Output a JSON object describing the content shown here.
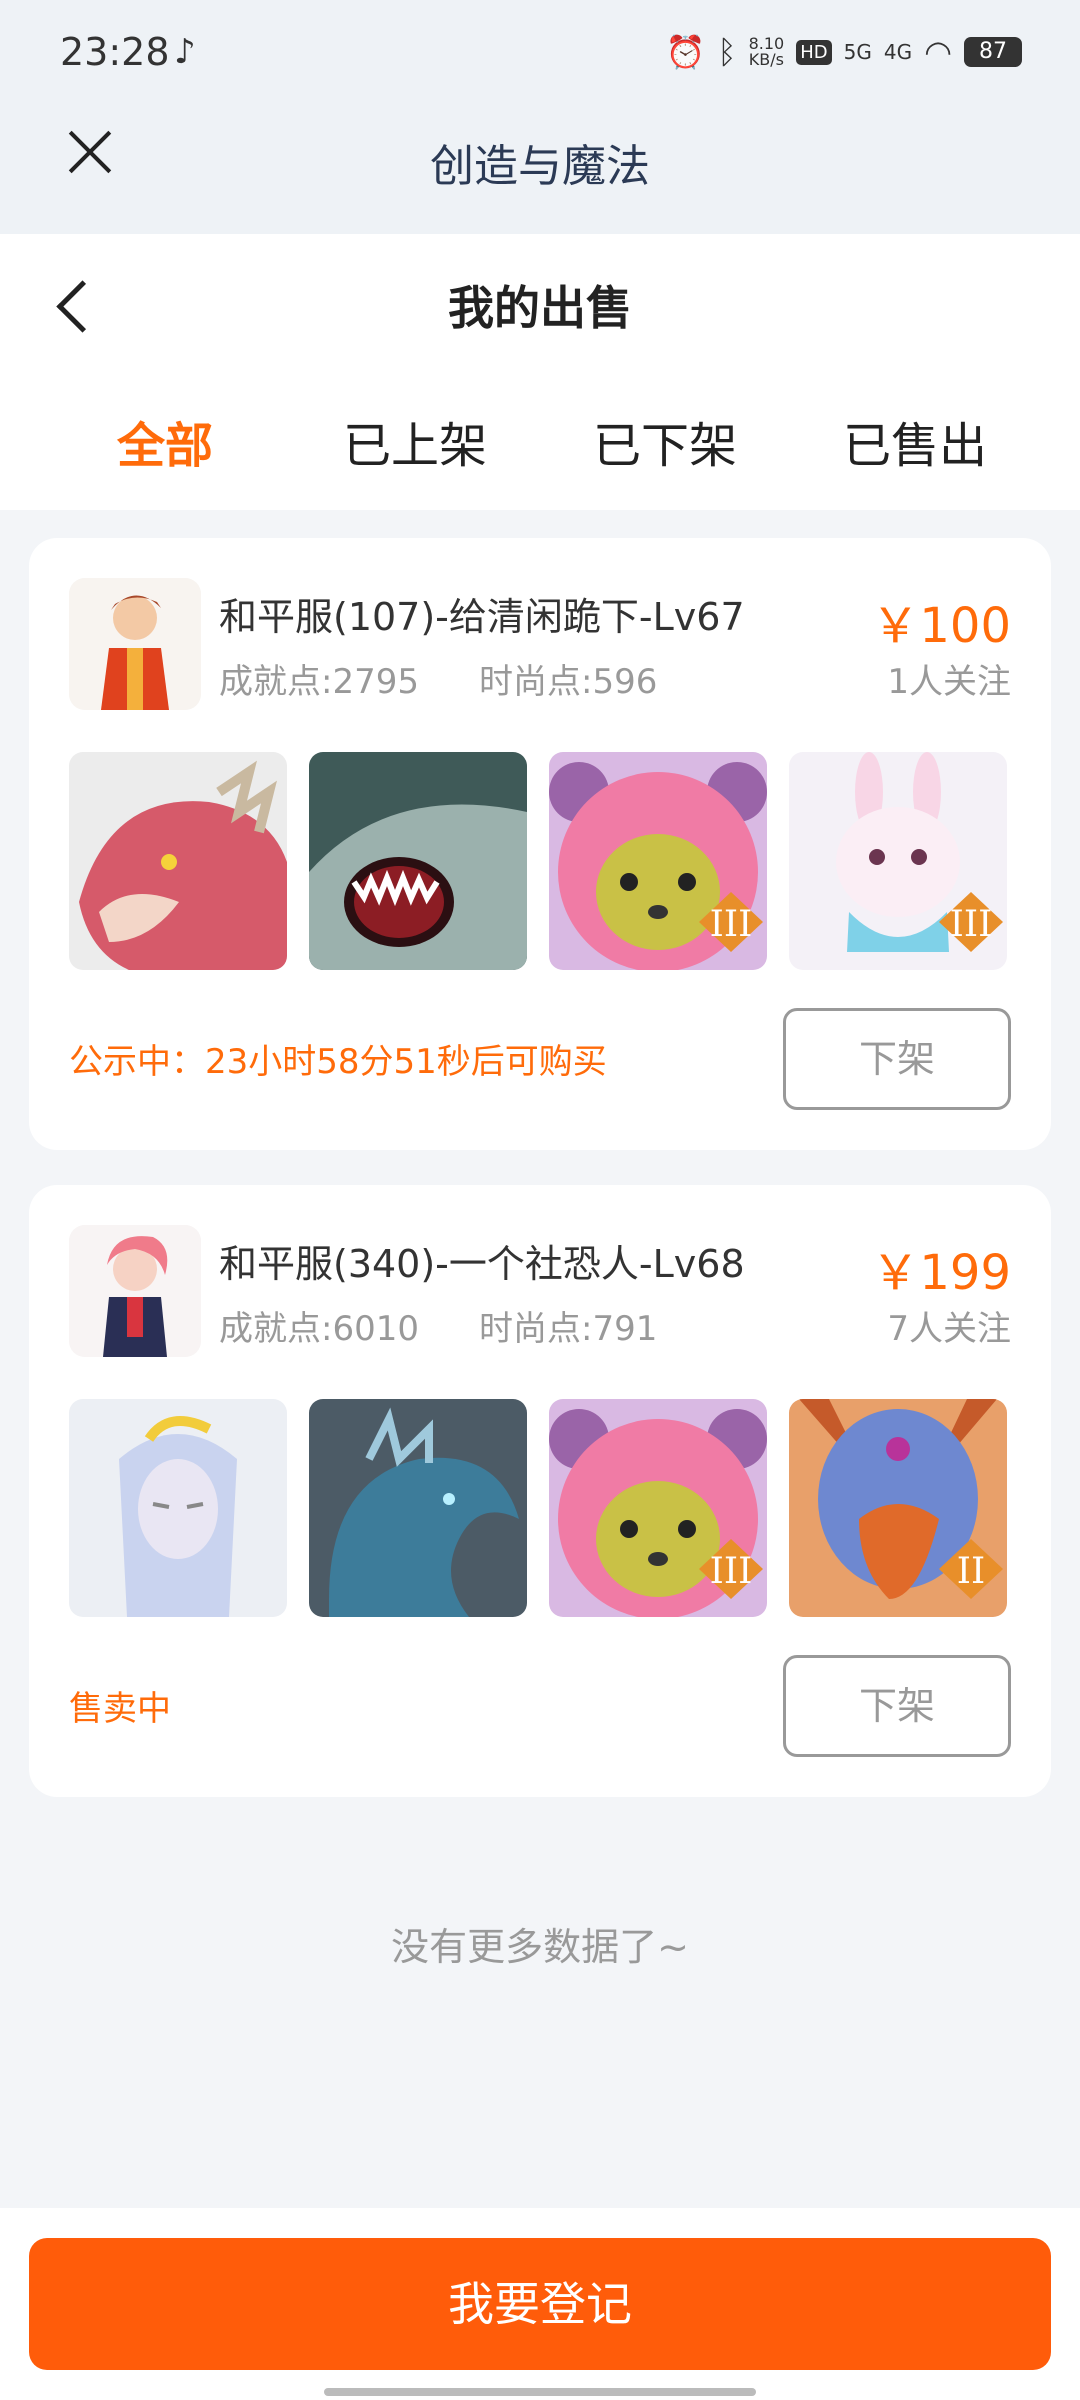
{
  "statusbar": {
    "time": "23:28",
    "net_speed_top": "8.10",
    "net_speed_bottom": "KB/s",
    "hd": "HD",
    "sig1": "5G",
    "sig2": "4G",
    "battery": "87"
  },
  "app": {
    "title": "创造与魔法"
  },
  "page": {
    "title": "我的出售"
  },
  "tabs": [
    {
      "label": "全部",
      "active": true
    },
    {
      "label": "已上架",
      "active": false
    },
    {
      "label": "已下架",
      "active": false
    },
    {
      "label": "已售出",
      "active": false
    }
  ],
  "listings": [
    {
      "title": "和平服(107)-给清闲跪下-Lv67",
      "achievement": "成就点:2795",
      "fashion": "时尚点:596",
      "price": "￥100",
      "watchers": "1人关注",
      "status": "公示中：23小时58分51秒后可购买",
      "button": "下架",
      "thumbs": [
        "red-dragon-head",
        "shark-head",
        "pink-bear-hood",
        "rabbit-mount"
      ]
    },
    {
      "title": "和平服(340)-一个社恐人-Lv68",
      "achievement": "成就点:6010",
      "fashion": "时尚点:791",
      "price": "￥199",
      "watchers": "7人关注",
      "status": "售卖中",
      "button": "下架",
      "thumbs": [
        "white-hair-character",
        "blue-dragon",
        "pink-bear-hood",
        "griffin-head"
      ]
    }
  ],
  "footer": {
    "no_more": "没有更多数据了~"
  },
  "bottom": {
    "register": "我要登记"
  }
}
